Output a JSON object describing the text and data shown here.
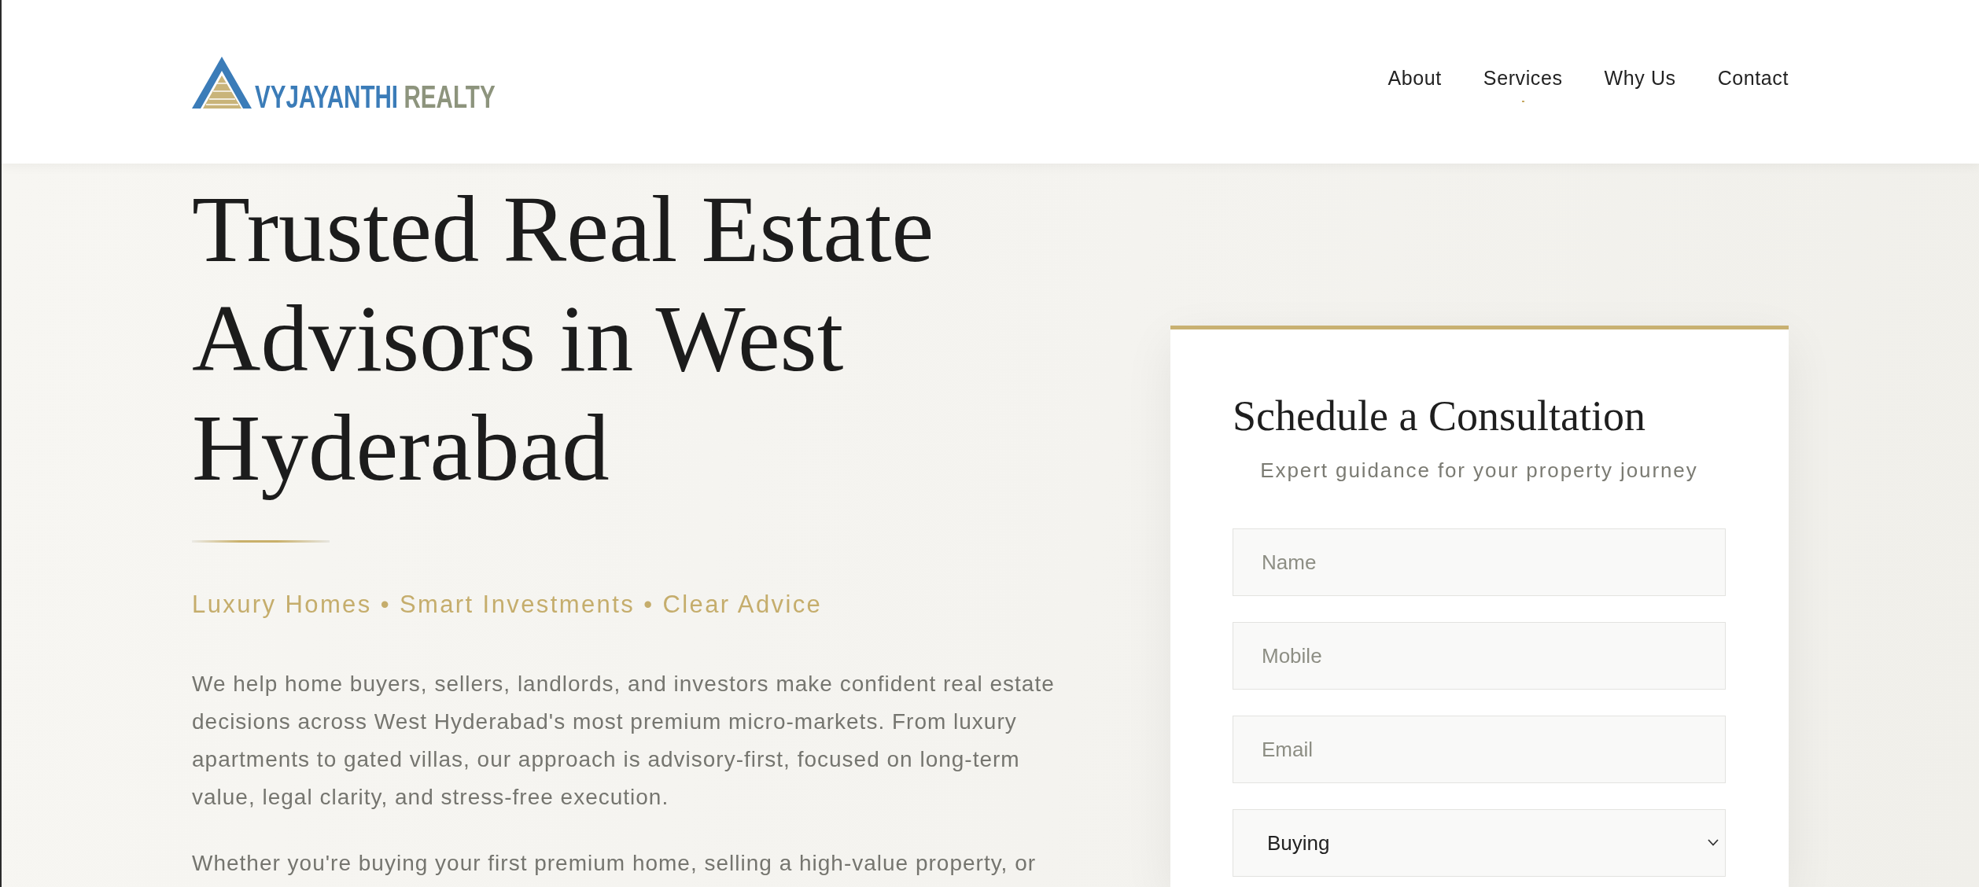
{
  "header": {
    "logo": {
      "primary": "VYJAYANTHI",
      "secondary": "REALTY"
    },
    "nav": [
      {
        "label": "About",
        "selected": false
      },
      {
        "label": "Services",
        "selected": true
      },
      {
        "label": "Why Us",
        "selected": false
      },
      {
        "label": "Contact",
        "selected": false
      }
    ]
  },
  "hero": {
    "heading": "Trusted Real Estate Advisors in West Hyderabad",
    "tagline": "Luxury Homes • Smart Investments • Clear Advice",
    "paragraphs": [
      "We help home buyers, sellers, landlords, and investors make confident real estate decisions across West Hyderabad's most premium micro-markets. From luxury apartments to gated villas, our approach is advisory-first, focused on long-term value, legal clarity, and stress-free execution.",
      "Whether you're buying your first premium home, selling a high-value property, or"
    ]
  },
  "consultation_form": {
    "title": "Schedule a Consultation",
    "subtitle": "Expert guidance for your property journey",
    "fields": [
      {
        "kind": "input",
        "placeholder": "Name"
      },
      {
        "kind": "input",
        "placeholder": "Mobile"
      },
      {
        "kind": "input",
        "placeholder": "Email"
      },
      {
        "kind": "select",
        "value": "Buying"
      }
    ]
  }
}
